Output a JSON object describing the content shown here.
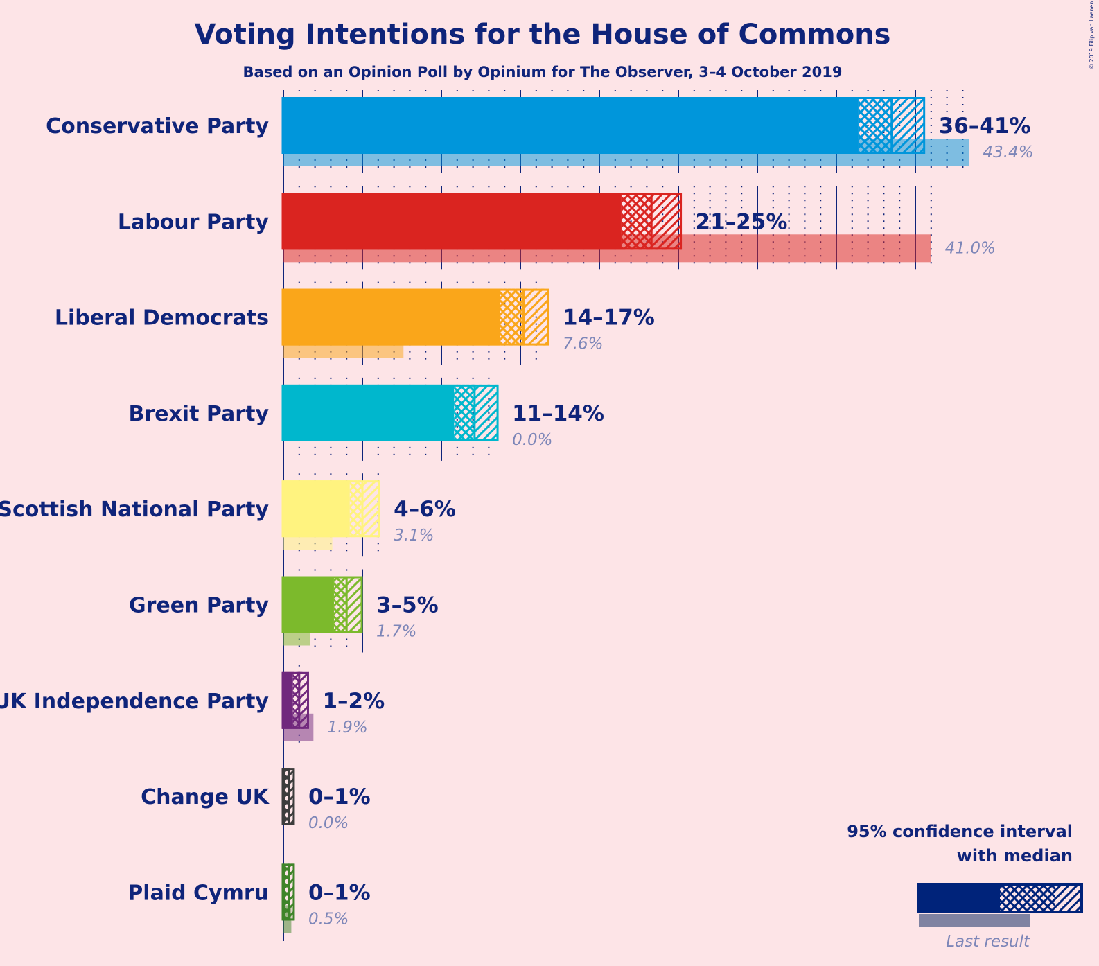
{
  "chart_data": {
    "type": "bar",
    "orientation": "horizontal",
    "title": "Voting Intentions for the House of Commons",
    "subtitle": "Based on an Opinion Poll by Opinium for The Observer, 3–4 October 2019",
    "copyright": "© 2019 Filip van Laenen",
    "xunit": "%",
    "grid": "solid every 5%, dotted every 1%",
    "legend": {
      "position": "bottom-right",
      "title_line1": "95% confidence interval",
      "title_line2": "with median",
      "last_result_label": "Last result"
    },
    "parties": [
      {
        "name": "Conservative Party",
        "color": "#0096DB",
        "low": 36.4,
        "median": 38.5,
        "high": 40.6,
        "range_label": "36–41%",
        "last": 43.4,
        "last_label": "43.4%"
      },
      {
        "name": "Labour Party",
        "color": "#DA2420",
        "low": 21.4,
        "median": 23.3,
        "high": 25.2,
        "range_label": "21–25%",
        "last": 41.0,
        "last_label": "41.0%"
      },
      {
        "name": "Liberal Democrats",
        "color": "#FAA61A",
        "low": 13.7,
        "median": 15.2,
        "high": 16.8,
        "range_label": "14–17%",
        "last": 7.6,
        "last_label": "7.6%"
      },
      {
        "name": "Brexit Party",
        "color": "#00B7CD",
        "low": 10.8,
        "median": 12.1,
        "high": 13.6,
        "range_label": "11–14%",
        "last": 0.0,
        "last_label": "0.0%"
      },
      {
        "name": "Scottish National Party",
        "color": "#FFF37F",
        "low": 4.2,
        "median": 5.0,
        "high": 6.1,
        "range_label": "4–6%",
        "last": 3.1,
        "last_label": "3.1%"
      },
      {
        "name": "Green Party",
        "color": "#7CBA2C",
        "low": 3.2,
        "median": 4.0,
        "high": 5.0,
        "range_label": "3–5%",
        "last": 1.7,
        "last_label": "1.7%"
      },
      {
        "name": "UK Independence Party",
        "color": "#70287D",
        "low": 0.6,
        "median": 1.0,
        "high": 1.6,
        "range_label": "1–2%",
        "last": 1.9,
        "last_label": "1.9%"
      },
      {
        "name": "Change UK",
        "color": "#3C3C3C",
        "low": 0.1,
        "median": 0.35,
        "high": 0.7,
        "range_label": "0–1%",
        "last": 0.0,
        "last_label": "0.0%"
      },
      {
        "name": "Plaid Cymru",
        "color": "#3F8429",
        "low": 0.1,
        "median": 0.35,
        "high": 0.7,
        "range_label": "0–1%",
        "last": 0.5,
        "last_label": "0.5%"
      }
    ]
  }
}
